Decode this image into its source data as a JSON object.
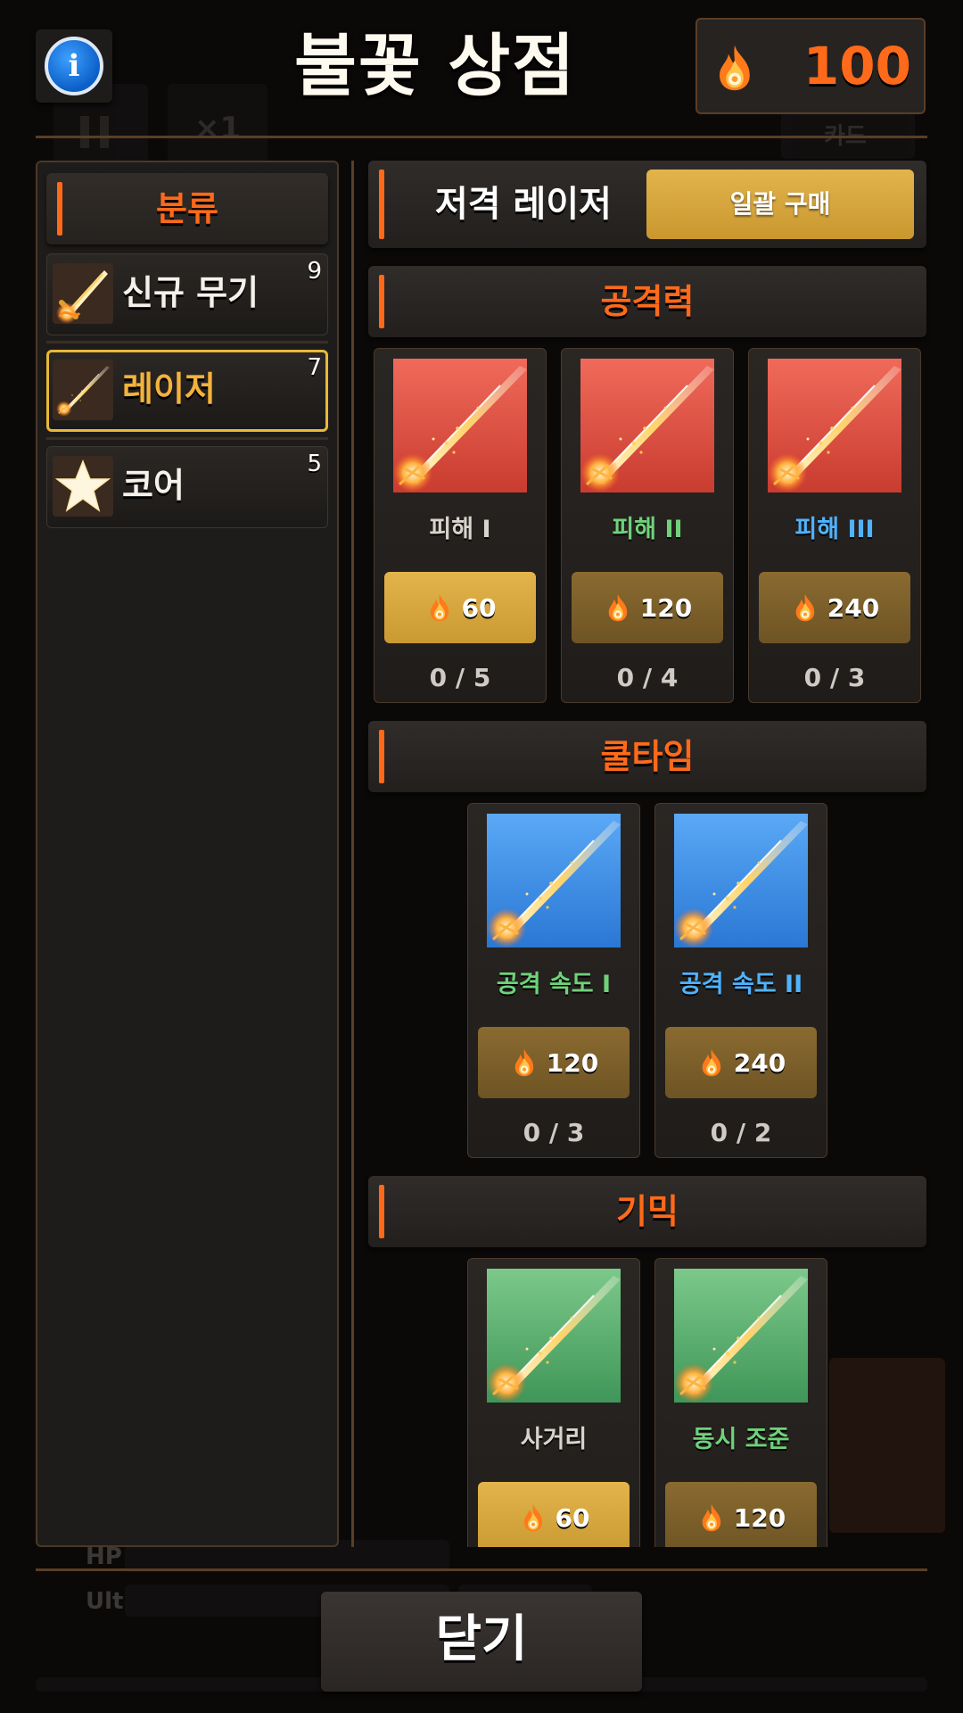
{
  "header": {
    "title": "불꽃 상점",
    "currency_value": "100",
    "info_icon": "info-icon",
    "currency_icon": "flame-icon"
  },
  "background_hud": {
    "speed_label": "×1",
    "card_label": "카드",
    "hp_label": "HP",
    "ult_label": "Ult"
  },
  "sidebar": {
    "header": "분류",
    "items": [
      {
        "label": "신규 무기",
        "count": "9",
        "icon": "sword-flame-icon",
        "selected": false
      },
      {
        "label": "레이저",
        "count": "7",
        "icon": "laser-icon",
        "selected": true
      },
      {
        "label": "코어",
        "count": "5",
        "icon": "star-icon",
        "selected": false
      }
    ]
  },
  "main": {
    "weapon_name": "저격 레이저",
    "bulk_buy_label": "일괄 구매",
    "sections": [
      {
        "title": "공격력",
        "cards": [
          {
            "name": "피해 I",
            "price": "60",
            "level": "0 / 5",
            "name_color": "#d8d3cc",
            "bg": "red",
            "button": "gold"
          },
          {
            "name": "피해 II",
            "price": "120",
            "level": "0 / 4",
            "name_color": "#6fd27a",
            "bg": "red",
            "button": "dim"
          },
          {
            "name": "피해 III",
            "price": "240",
            "level": "0 / 3",
            "name_color": "#4fb3ff",
            "bg": "red",
            "button": "dim"
          }
        ]
      },
      {
        "title": "쿨타임",
        "cards": [
          {
            "name": "공격 속도 I",
            "price": "120",
            "level": "0 / 3",
            "name_color": "#6fd27a",
            "bg": "blue",
            "button": "dim"
          },
          {
            "name": "공격 속도 II",
            "price": "240",
            "level": "0 / 2",
            "name_color": "#4fb3ff",
            "bg": "blue",
            "button": "dim"
          }
        ]
      },
      {
        "title": "기믹",
        "cards": [
          {
            "name": "사거리",
            "price": "60",
            "name_color": "#d8d3cc",
            "bg": "green",
            "button": "gold"
          },
          {
            "name": "동시 조준",
            "price": "120",
            "name_color": "#6fd27a",
            "bg": "green",
            "button": "dim"
          }
        ]
      }
    ]
  },
  "footer": {
    "close_label": "닫기"
  },
  "colors": {
    "accent": "#ff6a1a",
    "gold": "#e3b44c",
    "selected_border": "#e8b838"
  }
}
